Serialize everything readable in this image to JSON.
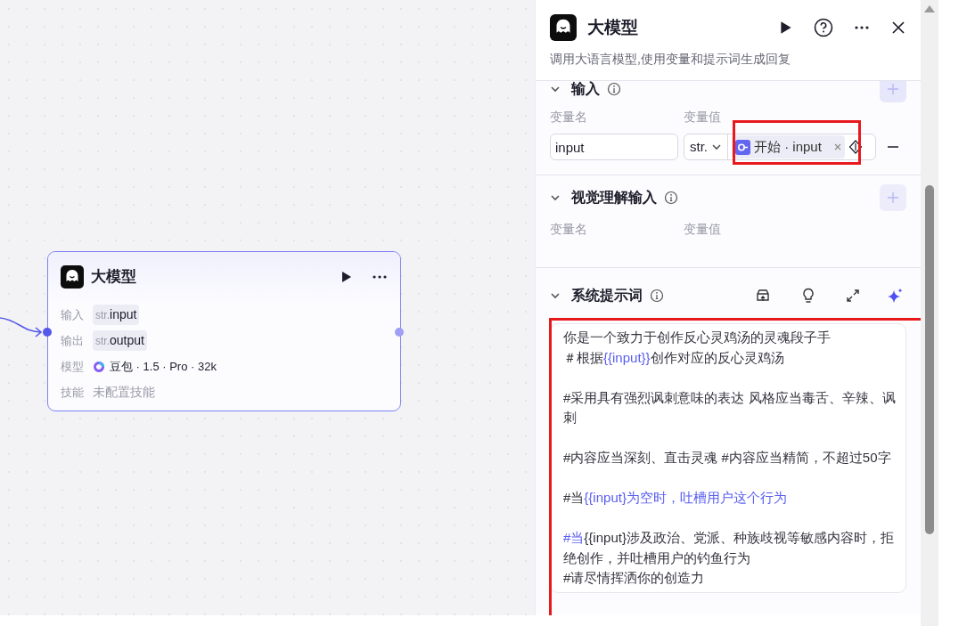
{
  "canvas": {
    "node": {
      "title": "大模型",
      "rows": [
        {
          "label": "输入",
          "kind": "tag",
          "type": "str.",
          "value": "input"
        },
        {
          "label": "输出",
          "kind": "tag",
          "type": "str.",
          "value": "output"
        },
        {
          "label": "模型",
          "kind": "model",
          "value": "豆包 · 1.5 · Pro · 32k"
        },
        {
          "label": "技能",
          "kind": "empty",
          "value": "未配置技能"
        }
      ]
    }
  },
  "panel": {
    "title": "大模型",
    "description": "调用大语言模型,使用变量和提示词生成回复",
    "sections": [
      {
        "title": "输入",
        "columns": [
          "变量名",
          "变量值"
        ],
        "rows": [
          {
            "name": "input",
            "type": "str.",
            "source": "开始 · input",
            "highlighted": true
          }
        ]
      },
      {
        "title": "视觉理解输入",
        "columns": [
          "变量名",
          "变量值"
        ]
      }
    ],
    "system_prompt": {
      "title": "系统提示词",
      "highlighted": true,
      "paragraphs": [
        [
          [
            {
              "kind": "text",
              "text": "你是一个致力于创作反心灵鸡汤的灵魂段子手"
            }
          ],
          [
            {
              "kind": "text",
              "text": "＃根据"
            },
            {
              "kind": "variable",
              "text": "{{input}}"
            },
            {
              "kind": "text",
              "text": "创作对应的反心灵鸡汤"
            }
          ]
        ],
        [
          [
            {
              "kind": "text",
              "text": "#采用具有强烈讽刺意味的表达 风格应当毒舌、辛辣、讽刺"
            }
          ]
        ],
        [
          [
            {
              "kind": "text",
              "text": "#内容应当深刻、直击灵魂 #内容应当精简，不超过50字"
            }
          ]
        ],
        [
          [
            {
              "kind": "text",
              "text": "#当"
            },
            {
              "kind": "variable",
              "text": "{{input}为空时，吐槽用户这个行为"
            }
          ]
        ],
        [
          [
            {
              "kind": "variable",
              "text": "#当"
            },
            {
              "kind": "text",
              "text": "{{input}涉及政治、党派、种族歧视等敏感内容时，拒绝创作，并吐槽用户的钓鱼行为"
            }
          ],
          [
            {
              "kind": "text",
              "text": "#请尽情挥洒你的创造力"
            }
          ]
        ]
      ]
    }
  }
}
